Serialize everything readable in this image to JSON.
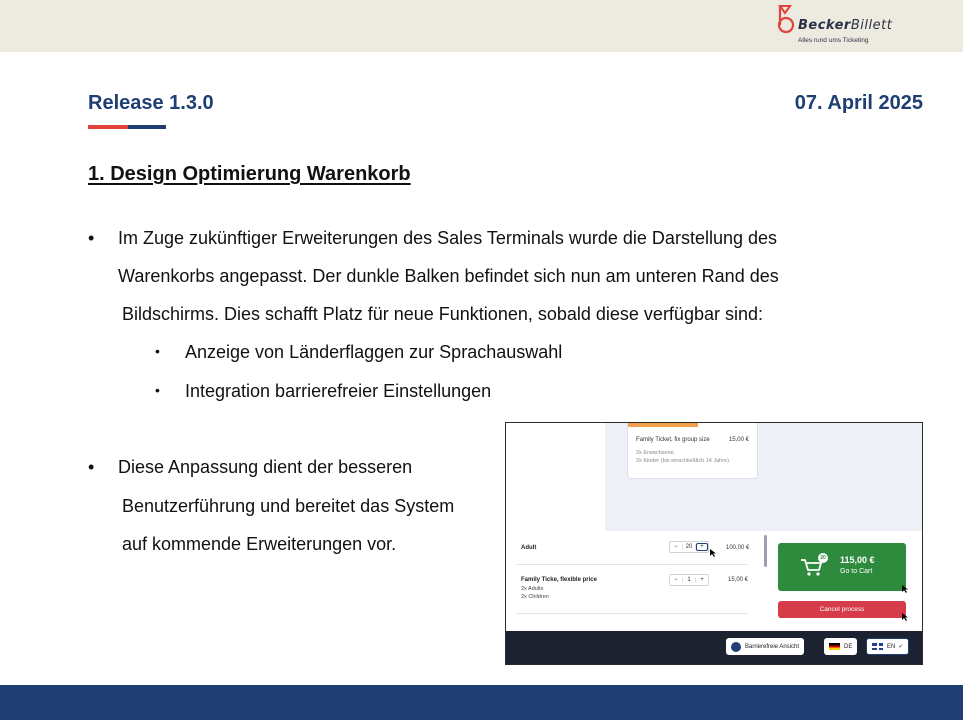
{
  "brand": {
    "name_bold": "Becker",
    "name_regular": "Billett",
    "tagline": "Alles rund ums Ticketing",
    "colors": {
      "navy": "#1f3e74",
      "red": "#e2423b",
      "header_bg": "#edeae0"
    }
  },
  "header": {
    "release": "Release 1.3.0",
    "date": "07. April 2025"
  },
  "section": {
    "title": "1. Design Optimierung Warenkorb",
    "bullet1": {
      "line1": "Im Zuge zukünftiger Erweiterungen des Sales Terminals wurde die Darstellung des",
      "line2": "Warenkorbs angepasst. Der dunkle Balken befindet sich nun am unteren Rand des",
      "line3": "Bildschirms. Dies schafft Platz für neue Funktionen, sobald diese verfügbar sind:",
      "sub1": "Anzeige von Länderflaggen zur Sprachauswahl",
      "sub2": "Integration barrierefreier Einstellungen"
    },
    "bullet2": {
      "line1": "Diese Anpassung dient der besseren",
      "line2": "Benutzerführung und bereitet das System",
      "line3": "auf kommende Erweiterungen vor."
    }
  },
  "screenshot": {
    "ticket": {
      "name": "Family Ticket, fix group size",
      "price": "15,00 €",
      "desc1": "2x Erwachsene,",
      "desc2": "2x Kinder (bis einschließlich 14 Jahre)"
    },
    "cart": {
      "rows": [
        {
          "label": "Adult",
          "qty": "20",
          "price": "100,00 €"
        },
        {
          "label": "Family Ticke, flexible price",
          "sub1": "2x Adults",
          "sub2": "2x Children",
          "qty": "1",
          "price": "15,00 €"
        }
      ],
      "minus": "−",
      "plus": "+",
      "badge": "20",
      "total": "115,00 €",
      "goto_label": "Go to Cart",
      "cancel_label": "Cancel process"
    },
    "bar": {
      "a11y_label": "Barrierefreie Ansicht",
      "lang_de": "DE",
      "lang_en": "EN",
      "check": "✓"
    }
  }
}
